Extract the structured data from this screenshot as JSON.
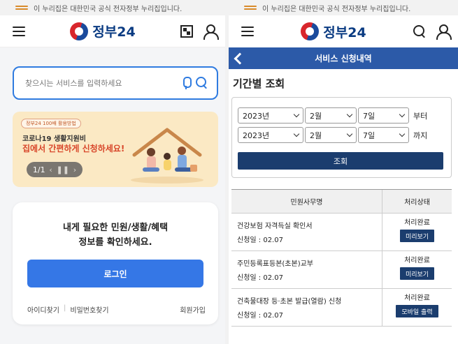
{
  "left": {
    "official_notice": "이 누리집은 대한민국 공식 전자정부 누리집입니다.",
    "logo_text": "정부24",
    "search": {
      "placeholder": "찾으시는 서비스를 입력하세요"
    },
    "banner": {
      "tag": "정부24 100배 활용방법",
      "line1": "코로나19 생활지원비",
      "line2": "집에서 간편하게 신청하세요!",
      "pager": {
        "current": "1",
        "total": "1"
      }
    },
    "login_card": {
      "message_line1": "내게 필요한 민원/생활/혜택",
      "message_line2": "정보를 확인하세요.",
      "login_button": "로그인",
      "find_id": "아이디찾기",
      "find_password": "비밀번호찾기",
      "signup": "회원가입"
    }
  },
  "right": {
    "official_notice": "이 누리집은 대한민국 공식 전자정부 누리집입니다.",
    "logo_text": "정부24",
    "bar_title": "서비스 신청내역",
    "section_title": "기간별 조회",
    "from": {
      "year": "2023년",
      "month": "2월",
      "day": "7일",
      "label": "부터"
    },
    "to": {
      "year": "2023년",
      "month": "2월",
      "day": "7일",
      "label": "까지"
    },
    "query_button": "조회",
    "table": {
      "headers": [
        "민원사무명",
        "처리상태"
      ],
      "rows": [
        {
          "name": "건강보험 자격득실 확인서",
          "date_label": "신청일 : ",
          "date": "02.07",
          "status": "처리완료",
          "action": "미리보기"
        },
        {
          "name": "주민등록표등본(초본)교부",
          "date_label": "신청일 : ",
          "date": "02.07",
          "status": "처리완료",
          "action": "미리보기"
        },
        {
          "name": "건축물대장 등·초본 발급(열람) 신청",
          "date_label": "신청일 : ",
          "date": "02.07",
          "status": "처리완료",
          "action": "모바일 출력"
        }
      ]
    }
  },
  "colors": {
    "primary_blue": "#3577e6",
    "navy": "#1b3d6e",
    "header_bar": "#2c5aa8",
    "banner_bg": "#fbe9c4"
  }
}
